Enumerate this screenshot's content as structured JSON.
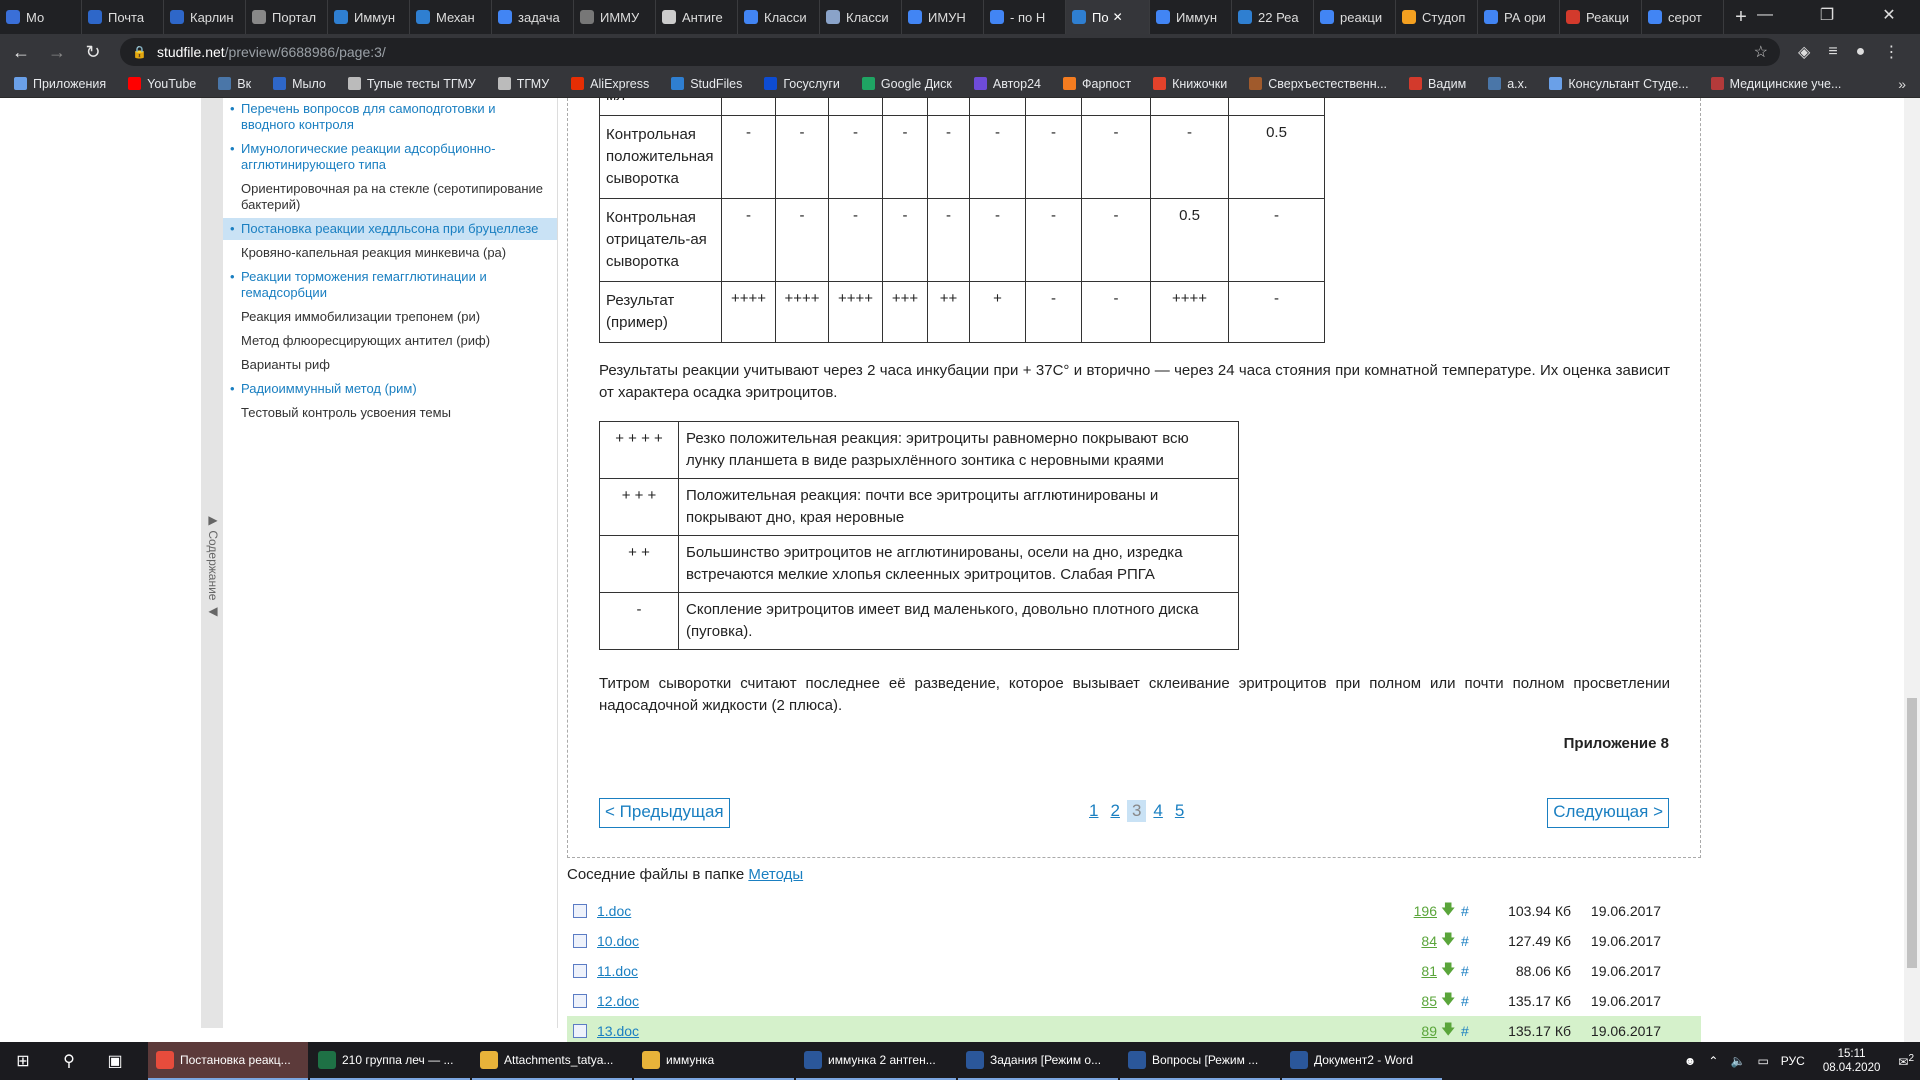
{
  "tabs": [
    {
      "label": "Мо",
      "color": "#3a6fd8"
    },
    {
      "label": "Почта",
      "color": "#2e67c9"
    },
    {
      "label": "Карлин",
      "color": "#2e67c9"
    },
    {
      "label": "Портал",
      "color": "#888888"
    },
    {
      "label": "Иммун",
      "color": "#2f7fd1"
    },
    {
      "label": "Механ",
      "color": "#2f7fd1"
    },
    {
      "label": "задача",
      "color": "#4285f4"
    },
    {
      "label": "ИММУ",
      "color": "#777777"
    },
    {
      "label": "Антиге",
      "color": "#cccccc"
    },
    {
      "label": "Класси",
      "color": "#4285f4"
    },
    {
      "label": "Класси",
      "color": "#8aa3c9"
    },
    {
      "label": "ИМУН",
      "color": "#4285f4"
    },
    {
      "label": "- по Н",
      "color": "#4285f4"
    },
    {
      "label": "По",
      "color": "#2f7fd1",
      "active": true
    },
    {
      "label": "Иммун",
      "color": "#4285f4"
    },
    {
      "label": "22 Реа",
      "color": "#2f7fd1"
    },
    {
      "label": "реакци",
      "color": "#4285f4"
    },
    {
      "label": "Студоп",
      "color": "#f4a020"
    },
    {
      "label": "РА ори",
      "color": "#4285f4"
    },
    {
      "label": "Реакци",
      "color": "#d33a2c"
    },
    {
      "label": "серот",
      "color": "#4285f4"
    }
  ],
  "new_tab": "+",
  "window_controls": [
    "—",
    "❐",
    "✕"
  ],
  "url_host": "studfile.net",
  "url_path": "/preview/6688986/page:3/",
  "bookmarks": [
    {
      "label": "Приложения",
      "color": "#6aa0e8"
    },
    {
      "label": "YouTube",
      "color": "#ff0000"
    },
    {
      "label": "Вк",
      "color": "#4a76a8"
    },
    {
      "label": "Мыло",
      "color": "#2e67c9"
    },
    {
      "label": "Тупые тесты ТГМУ",
      "color": "#bbbbbb"
    },
    {
      "label": "ТГМУ",
      "color": "#bbbbbb"
    },
    {
      "label": "AliExpress",
      "color": "#e62e04"
    },
    {
      "label": "StudFiles",
      "color": "#2f7fd1"
    },
    {
      "label": "Госуслуги",
      "color": "#0d4cd3"
    },
    {
      "label": "Google Диск",
      "color": "#1fa463"
    },
    {
      "label": "Автор24",
      "color": "#6e4bd8"
    },
    {
      "label": "Фарпост",
      "color": "#f47c20"
    },
    {
      "label": "Книжочки",
      "color": "#e2422b"
    },
    {
      "label": "Сверхъестественн...",
      "color": "#a05a2c"
    },
    {
      "label": "Вадим",
      "color": "#d33a2c"
    },
    {
      "label": "а.х.",
      "color": "#4a76a8"
    },
    {
      "label": "Консультант Студе...",
      "color": "#6aa0e8"
    },
    {
      "label": "Медицинские уче...",
      "color": "#b33a3a"
    }
  ],
  "bookmarks_more": "»",
  "toc_label": "▶ Содержание ◀",
  "sidebar_items": [
    {
      "label": "Перечень вопросов для самоподготовки и вводного контроля",
      "link": true
    },
    {
      "label": "Имунологические реакции адсорбционно-агглютинирующего типа",
      "link": true
    },
    {
      "label": "Ориентировочная ра на стекле (серотипирование бактерий)",
      "link": false
    },
    {
      "label": "Постановка реакции хеддльсона при бруцеллезе",
      "link": true,
      "selected": true
    },
    {
      "label": "Кровяно-капельная реакция минкевича (ра)",
      "link": false
    },
    {
      "label": "Реакции торможения гемагглютинации и гемадсорбции",
      "link": true
    },
    {
      "label": "Реакция иммобилизации трепонем (ри)",
      "link": false
    },
    {
      "label": "Метод флюоресцирующих антител (риф)",
      "link": false
    },
    {
      "label": "Варианты риф",
      "link": false
    },
    {
      "label": "Радиоиммунный метод (рим)",
      "link": true
    },
    {
      "label": "Тестовый контроль усвоения темы",
      "link": false
    }
  ],
  "results_table": {
    "top_cell": "мл",
    "rows": [
      {
        "head": "Контрольная положительная сыворотка",
        "cells": [
          "-",
          "-",
          "-",
          "-",
          "-",
          "-",
          "-",
          "-",
          "-",
          "0.5"
        ]
      },
      {
        "head": "Контрольная отрицатель-ая сыворотка",
        "cells": [
          "-",
          "-",
          "-",
          "-",
          "-",
          "-",
          "-",
          "-",
          "0.5",
          "-"
        ]
      },
      {
        "head": "Результат (пример)",
        "cells": [
          "++++",
          "++++",
          "++++",
          "+++",
          "++",
          "+",
          "-",
          "-",
          "++++",
          "-"
        ]
      }
    ]
  },
  "para_results": "Результаты реакции учитывают через 2 часа инкубации при + 37С° и вторично — через 24 часа стояния при комнатной температуре. Их оценка зависит от характера осадка эритроцитов.",
  "legend_rows": [
    {
      "sign": "+ + + +",
      "text": "Резко положительная реакция: эритроциты равномерно покрывают всю лунку планшета в виде разрыхлённого зонтика с неровными краями"
    },
    {
      "sign": "+ + +",
      "text": "Положительная реакция: почти все эритроциты агглютинированы и покрывают дно, края неровные"
    },
    {
      "sign": "+ +",
      "text": "Большинство эритроцитов не агглютинированы, осели на дно, изредка встречаются мелкие хлопья склеенных эритроцитов. Слабая РПГА"
    },
    {
      "sign": "-",
      "text": "Скопление эритроцитов имеет вид маленького, довольно плотного диска (пуговка)."
    }
  ],
  "para_titer": "Титром сыворотки считают последнее её разведение, которое вызывает склеивание эритроцитов при полном или почти полном просветлении надосадочной жидкости (2 плюса).",
  "appendix": "Приложение 8",
  "prev_label": "< Предыдущая",
  "next_label": "Следующая >",
  "pages": [
    "1",
    "2",
    "3",
    "4",
    "5"
  ],
  "current_page": "3",
  "neighbors_prefix": "Соседние файлы в папке",
  "neighbors_folder": "Методы",
  "files": [
    {
      "name": "1.doc",
      "count": "196",
      "size": "103.94 Кб",
      "date": "19.06.2017"
    },
    {
      "name": "10.doc",
      "count": "84",
      "size": "127.49 Кб",
      "date": "19.06.2017"
    },
    {
      "name": "11.doc",
      "count": "81",
      "size": "88.06 Кб",
      "date": "19.06.2017"
    },
    {
      "name": "12.doc",
      "count": "85",
      "size": "135.17 Кб",
      "date": "19.06.2017"
    },
    {
      "name": "13.doc",
      "count": "89",
      "size": "135.17 Кб",
      "date": "19.06.2017",
      "highlight": true
    }
  ],
  "file_hash": "#",
  "taskbar_apps": [
    {
      "label": "Постановка реакц...",
      "color": "#e74c3c",
      "active": true
    },
    {
      "label": "210 группа леч — ...",
      "color": "#1e7145"
    },
    {
      "label": "Attachments_tatya...",
      "color": "#e8b33a"
    },
    {
      "label": "иммунка",
      "color": "#e8b33a"
    },
    {
      "label": "иммунка 2 антген...",
      "color": "#2b579a"
    },
    {
      "label": "Задания [Режим о...",
      "color": "#2b579a"
    },
    {
      "label": "Вопросы [Режим ...",
      "color": "#2b579a"
    },
    {
      "label": "Документ2 - Word",
      "color": "#2b579a"
    }
  ],
  "tray_lang": "РУС",
  "clock_time": "15:11",
  "clock_date": "08.04.2020",
  "notif_count": "2"
}
